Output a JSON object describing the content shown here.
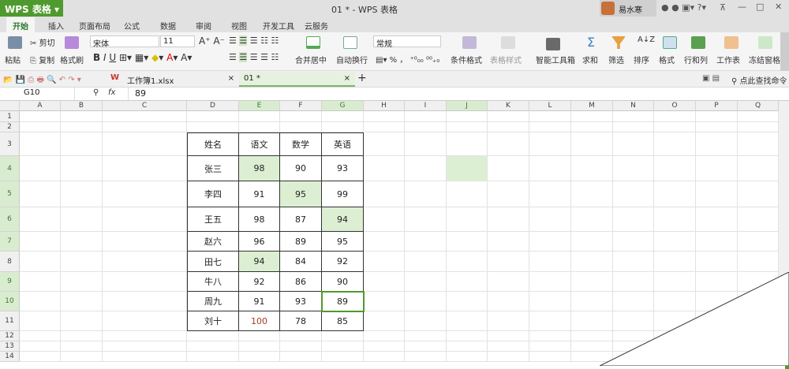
{
  "app": {
    "logo": "WPS 表格",
    "title": "01 * - WPS 表格",
    "user": "易水寒"
  },
  "tabs": [
    "开始",
    "插入",
    "页面布局",
    "公式",
    "数据",
    "审阅",
    "视图",
    "开发工具",
    "云服务"
  ],
  "ribbon": {
    "paste": "粘贴",
    "cut": "剪切",
    "copy": "复制",
    "format_painter": "格式刷",
    "font": "宋体",
    "size": "11",
    "number_format": "常规",
    "merge": "合并居中",
    "wrap": "自动换行",
    "cond_format": "条件格式",
    "table_style": "表格样式",
    "smart_tools": "智能工具箱",
    "sum": "求和",
    "filter": "筛选",
    "sort": "排序",
    "format": "格式",
    "rowcol": "行和列",
    "sheet": "工作表",
    "freeze": "冻结窗格"
  },
  "doc_tabs": [
    "工作簿1.xlsx",
    "01 *"
  ],
  "search_cmd": "点此查找命令",
  "namebox": "G10",
  "fx": "fx",
  "formula": "89",
  "columns": [
    "A",
    "B",
    "C",
    "D",
    "E",
    "F",
    "G",
    "H",
    "I",
    "J",
    "K",
    "L",
    "M",
    "N",
    "O",
    "P",
    "Q"
  ],
  "rows": [
    "1",
    "2",
    "3",
    "4",
    "5",
    "6",
    "7",
    "8",
    "9",
    "10",
    "11",
    "12",
    "13",
    "14"
  ],
  "table": {
    "headers": [
      "姓名",
      "语文",
      "数学",
      "英语"
    ],
    "rows": [
      [
        "张三",
        "98",
        "90",
        "93"
      ],
      [
        "李四",
        "91",
        "95",
        "99"
      ],
      [
        "王五",
        "98",
        "87",
        "94"
      ],
      [
        "赵六",
        "96",
        "89",
        "95"
      ],
      [
        "田七",
        "94",
        "84",
        "92"
      ],
      [
        "牛八",
        "92",
        "86",
        "90"
      ],
      [
        "周九",
        "91",
        "93",
        "89"
      ],
      [
        "刘十",
        "100",
        "78",
        "85"
      ]
    ]
  },
  "colors": {
    "accent": "#4f9a2e",
    "highlight": "#d9ecd0"
  }
}
